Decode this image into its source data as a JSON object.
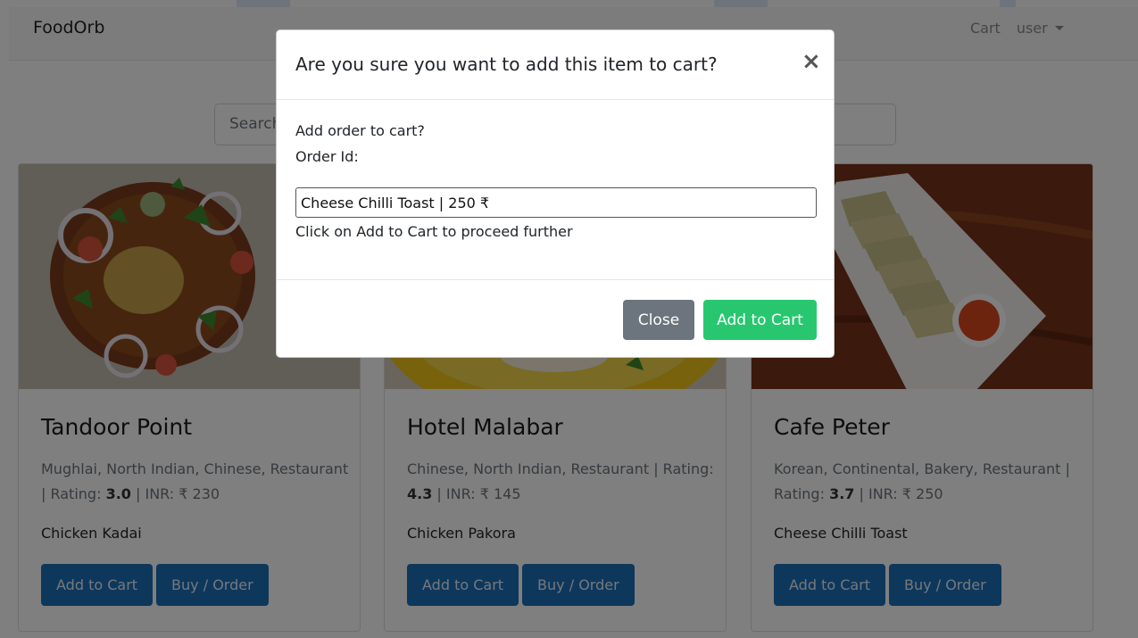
{
  "navbar": {
    "brand": "FoodOrb",
    "cart_link": "Cart",
    "user_menu": "user"
  },
  "search": {
    "placeholder": "Search"
  },
  "cards": [
    {
      "title": "Tandoor Point",
      "cuisines": "Mughlai, North Indian, Chinese, Restaurant",
      "rating_label": "Rating:",
      "rating": "3.0",
      "price_label": "INR: ₹ 230",
      "dish": "Chicken Kadai",
      "add_label": "Add to Cart",
      "buy_label": "Buy / Order"
    },
    {
      "title": "Hotel Malabar",
      "cuisines": "Chinese, North Indian, Restaurant",
      "rating_label": "Rating:",
      "rating": "4.3",
      "price_label": "INR: ₹ 145",
      "dish": "Chicken Pakora",
      "add_label": "Add to Cart",
      "buy_label": "Buy / Order"
    },
    {
      "title": "Cafe Peter",
      "cuisines": "Korean, Continental, Bakery, Restaurant",
      "rating_label": "Rating:",
      "rating": "3.7",
      "price_label": "INR: ₹ 250",
      "dish": "Cheese Chilli Toast",
      "add_label": "Add to Cart",
      "buy_label": "Buy / Order"
    }
  ],
  "modal": {
    "title": "Are you sure you want to add this item to cart?",
    "close_symbol": "×",
    "line1": "Add order to cart?",
    "line2": "Order Id:",
    "order_value": "Cheese Chilli Toast | 250 ₹",
    "hint": "Click on Add to Cart to proceed further",
    "close_label": "Close",
    "add_label": "Add to Cart"
  },
  "colors": {
    "primary_button": "#1d6fb8",
    "success_button": "#28c76f",
    "secondary_button": "#6c757d"
  }
}
